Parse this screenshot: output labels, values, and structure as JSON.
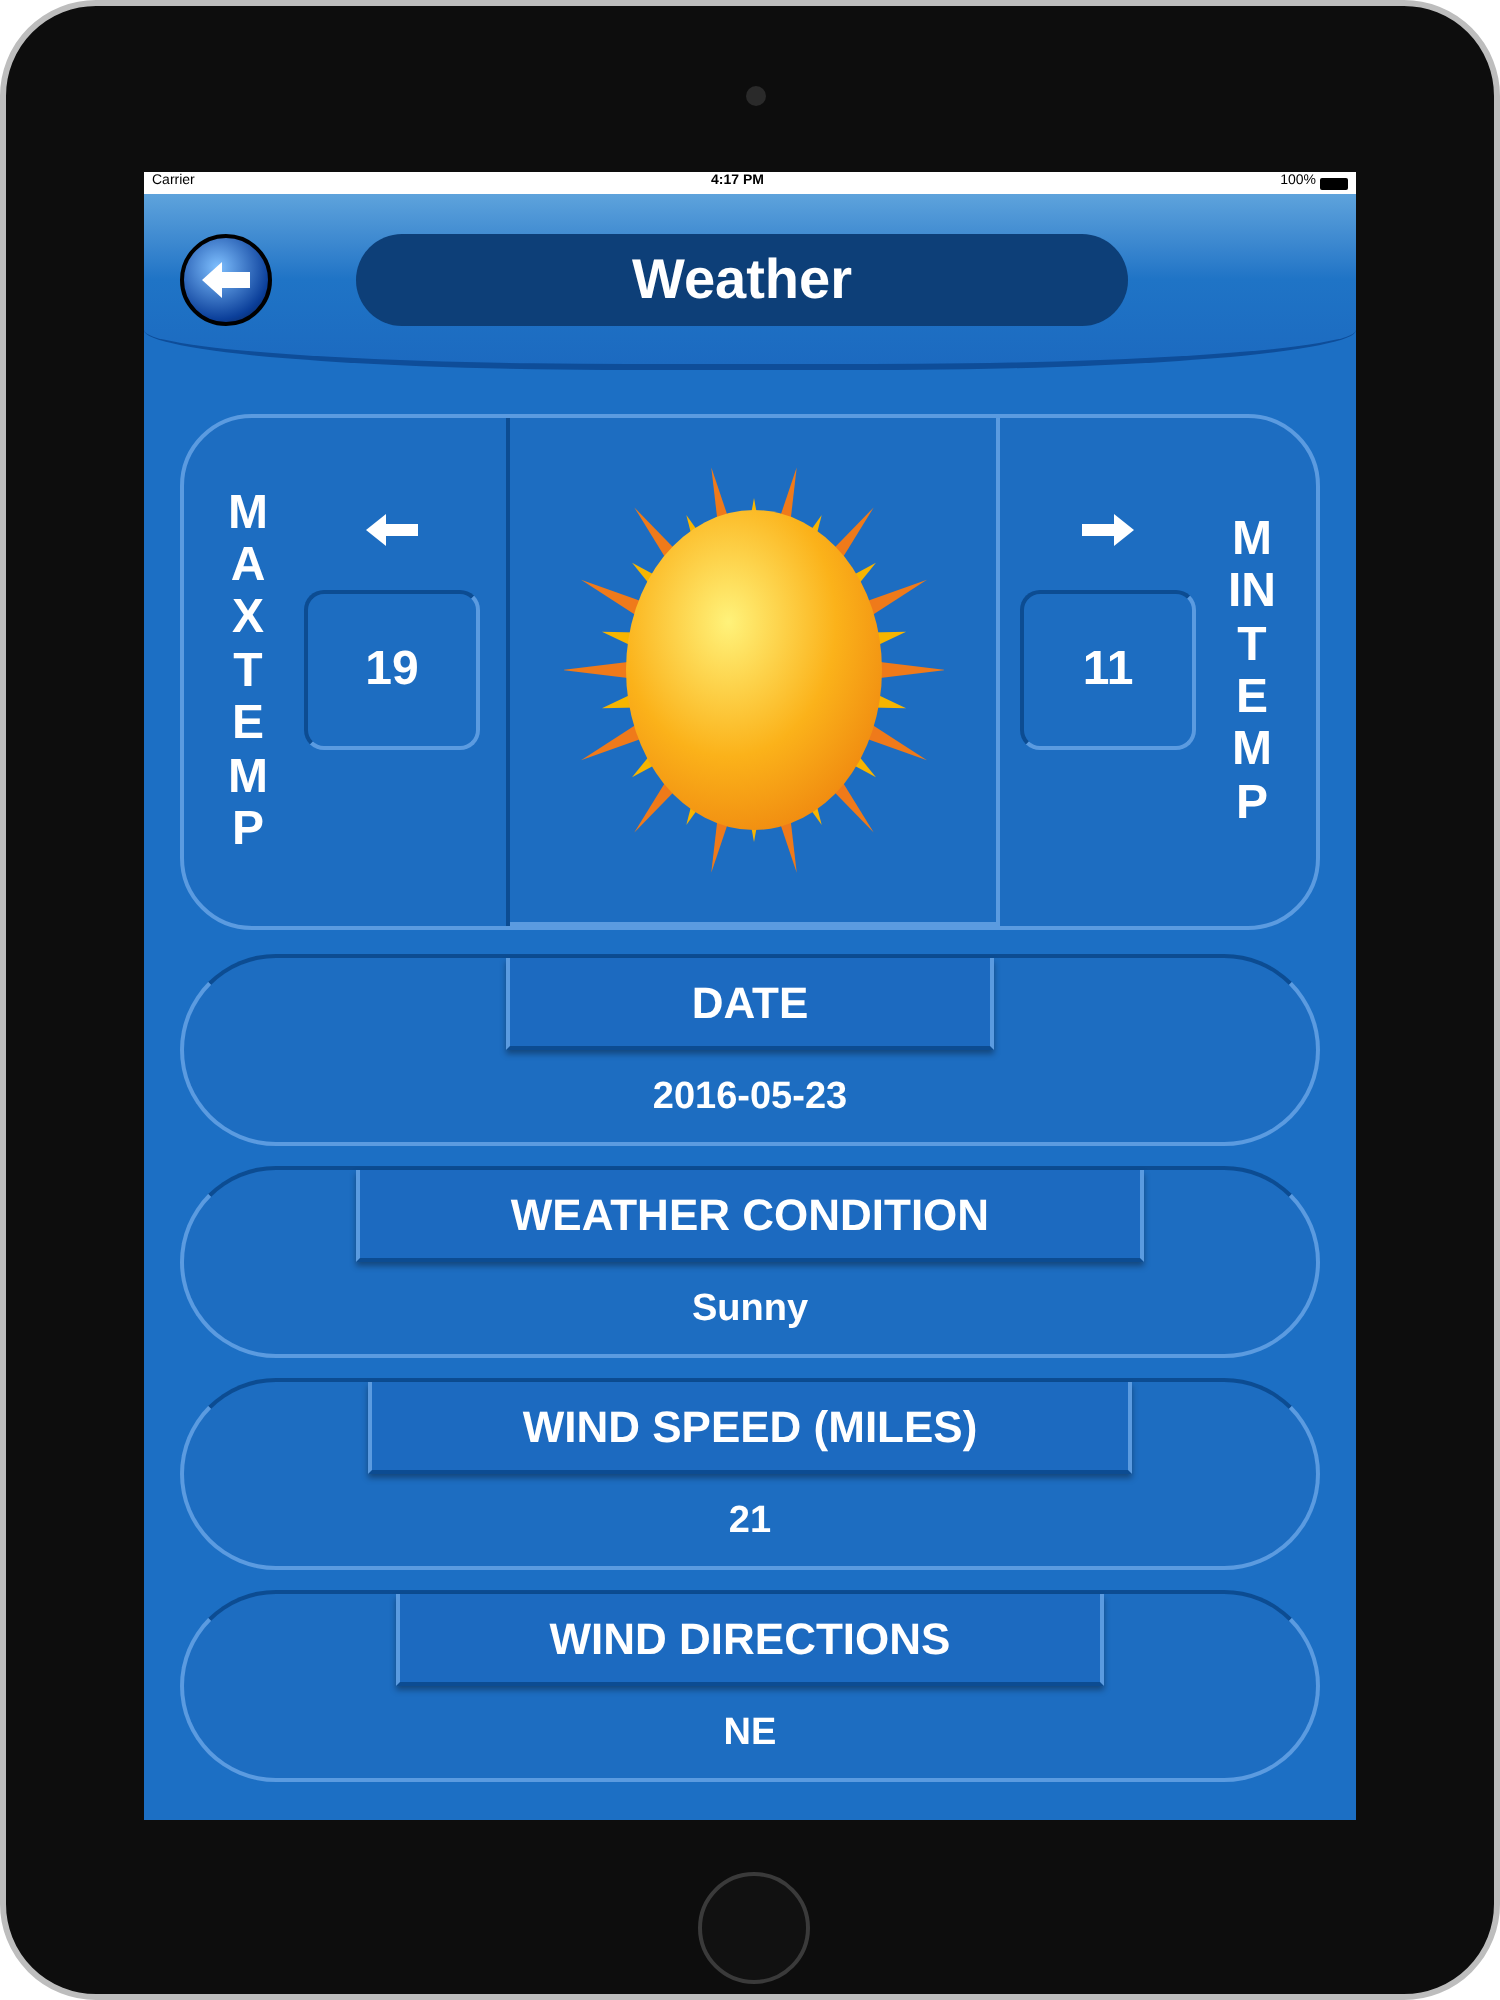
{
  "status_bar": {
    "carrier": "Carrier",
    "time": "4:17 PM",
    "battery": "100%"
  },
  "title": "Weather",
  "max_temp": {
    "label": "MAX TEMP",
    "value": "19"
  },
  "min_temp": {
    "label": "MIN TEMP",
    "value": "11"
  },
  "fields": [
    {
      "label": "DATE",
      "value": "2016-05-23"
    },
    {
      "label": "WEATHER CONDITION",
      "value": "Sunny"
    },
    {
      "label": "WIND SPEED (MILES)",
      "value": "21"
    },
    {
      "label": "WIND DIRECTIONS",
      "value": "NE"
    }
  ]
}
